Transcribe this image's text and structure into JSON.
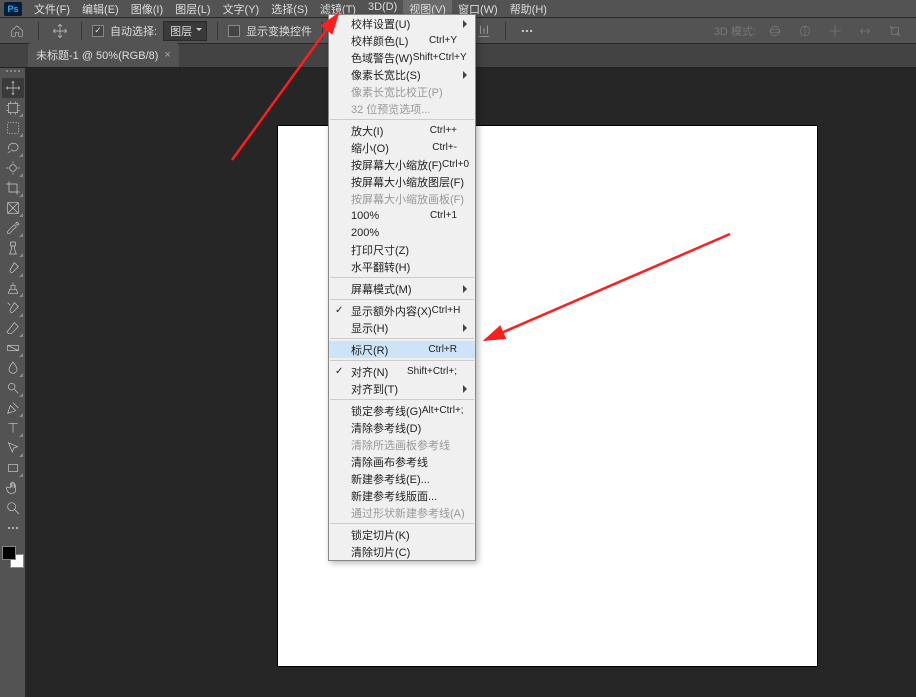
{
  "app": {
    "logo": "Ps"
  },
  "menubar": {
    "items": [
      {
        "label": "文件(F)"
      },
      {
        "label": "编辑(E)"
      },
      {
        "label": "图像(I)"
      },
      {
        "label": "图层(L)"
      },
      {
        "label": "文字(Y)"
      },
      {
        "label": "选择(S)"
      },
      {
        "label": "滤镜(T)"
      },
      {
        "label": "3D(D)"
      },
      {
        "label": "视图(V)",
        "active": true
      },
      {
        "label": "窗口(W)"
      },
      {
        "label": "帮助(H)"
      }
    ]
  },
  "optbar": {
    "auto_select_label": "自动选择:",
    "auto_select_target": "图层",
    "show_transform_label": "显示变换控件",
    "mode3d_label": "3D 模式:"
  },
  "tab": {
    "title": "未标题-1 @ 50%(RGB/8)"
  },
  "view_menu": {
    "groups": [
      [
        {
          "label": "校样设置(U)",
          "submenu": true
        },
        {
          "label": "校样颜色(L)",
          "shortcut": "Ctrl+Y"
        },
        {
          "label": "色域警告(W)",
          "shortcut": "Shift+Ctrl+Y"
        },
        {
          "label": "像素长宽比(S)",
          "submenu": true
        },
        {
          "label": "像素长宽比校正(P)",
          "disabled": true
        },
        {
          "label": "32 位预览选项...",
          "disabled": true
        }
      ],
      [
        {
          "label": "放大(I)",
          "shortcut": "Ctrl++"
        },
        {
          "label": "缩小(O)",
          "shortcut": "Ctrl+-"
        },
        {
          "label": "按屏幕大小缩放(F)",
          "shortcut": "Ctrl+0"
        },
        {
          "label": "按屏幕大小缩放图层(F)"
        },
        {
          "label": "按屏幕大小缩放画板(F)",
          "disabled": true
        },
        {
          "label": "100%",
          "shortcut": "Ctrl+1"
        },
        {
          "label": "200%"
        },
        {
          "label": "打印尺寸(Z)"
        },
        {
          "label": "水平翻转(H)"
        }
      ],
      [
        {
          "label": "屏幕模式(M)",
          "submenu": true
        }
      ],
      [
        {
          "label": "显示额外内容(X)",
          "shortcut": "Ctrl+H",
          "checked": true
        },
        {
          "label": "显示(H)",
          "submenu": true
        }
      ],
      [
        {
          "label": "标尺(R)",
          "shortcut": "Ctrl+R",
          "highlight": true
        }
      ],
      [
        {
          "label": "对齐(N)",
          "shortcut": "Shift+Ctrl+;",
          "checked": true
        },
        {
          "label": "对齐到(T)",
          "submenu": true
        }
      ],
      [
        {
          "label": "锁定参考线(G)",
          "shortcut": "Alt+Ctrl+;"
        },
        {
          "label": "清除参考线(D)"
        },
        {
          "label": "清除所选画板参考线",
          "disabled": true
        },
        {
          "label": "清除画布参考线"
        },
        {
          "label": "新建参考线(E)..."
        },
        {
          "label": "新建参考线版面..."
        },
        {
          "label": "通过形状新建参考线(A)",
          "disabled": true
        }
      ],
      [
        {
          "label": "锁定切片(K)"
        },
        {
          "label": "清除切片(C)"
        }
      ]
    ]
  },
  "tool_names": [
    "move-tool",
    "artboard-tool",
    "rect-marquee-tool",
    "lasso-tool",
    "quick-select-tool",
    "crop-tool",
    "frame-tool",
    "eyedropper-tool",
    "spot-heal-tool",
    "brush-tool",
    "clone-stamp-tool",
    "history-brush-tool",
    "eraser-tool",
    "gradient-tool",
    "blur-tool",
    "dodge-tool",
    "pen-tool",
    "type-tool",
    "path-select-tool",
    "rectangle-tool",
    "hand-tool",
    "zoom-tool",
    "edit-toolbar"
  ]
}
